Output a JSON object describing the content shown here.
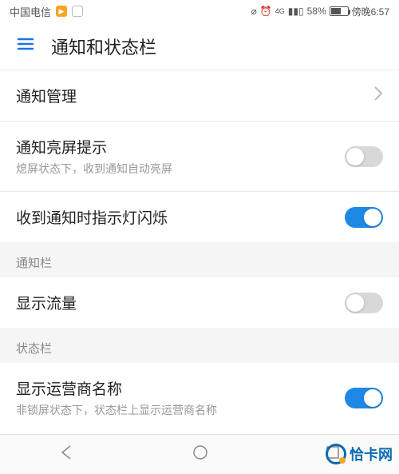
{
  "status_bar": {
    "carrier": "中国电信",
    "battery_pct": "58%",
    "time": "傍晚6:57",
    "net_label": "4G"
  },
  "header": {
    "title": "通知和状态栏"
  },
  "rows": {
    "notif_mgmt": {
      "title": "通知管理"
    },
    "screen_on": {
      "title": "通知亮屏提示",
      "subtitle": "熄屏状态下，收到通知自动亮屏",
      "on": false
    },
    "led_blink": {
      "title": "收到通知时指示灯闪烁",
      "on": true
    },
    "show_traffic": {
      "title": "显示流量",
      "on": false
    },
    "show_carrier": {
      "title": "显示运营商名称",
      "subtitle": "非锁屏状态下，状态栏上显示运营商名称",
      "on": true
    }
  },
  "sections": {
    "notif_bar": "通知栏",
    "status_bar": "状态栏"
  },
  "watermark": "恰卡网"
}
